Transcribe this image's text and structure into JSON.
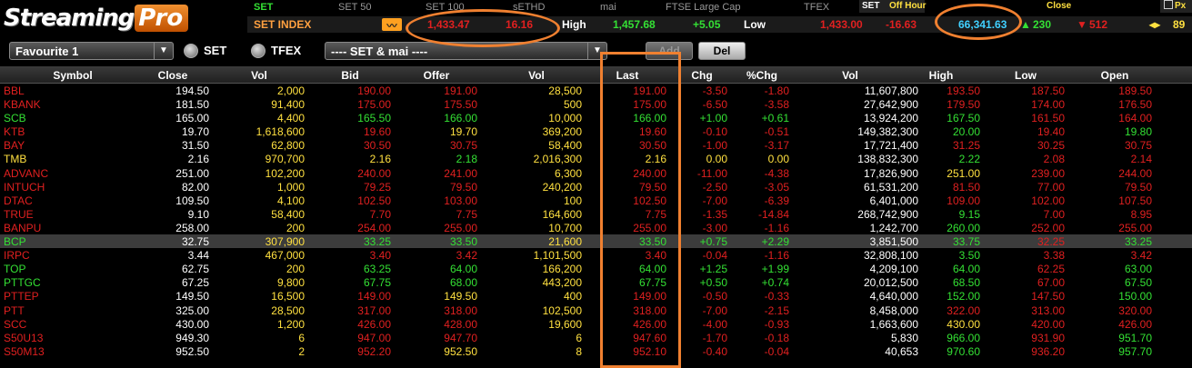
{
  "app": {
    "logo_main": "Streaming",
    "logo_accent": "Pro"
  },
  "tabs": [
    "SET",
    "SET 50",
    "SET 100",
    "sETHD",
    "mai",
    "FTSE Large Cap",
    "TFEX"
  ],
  "status": {
    "market": "SET",
    "session": "Off Hour",
    "close_label": "Close",
    "tab_right": "Px"
  },
  "index_bar": {
    "name": "SET INDEX",
    "value": "1,433.47",
    "change": "16.16",
    "high_label": "High",
    "high": "1,457.68",
    "high_chg": "+5.05",
    "low_label": "Low",
    "low": "1,433.00",
    "low_chg": "-16.63",
    "volume": "66,341.63",
    "up_count": "230",
    "down_count": "512",
    "unch_count": "89"
  },
  "controls": {
    "favourite": "Favourite 1",
    "radio_set": "SET",
    "radio_tfex": "TFEX",
    "market_filter": "---- SET & mai ----",
    "add_label": "Add",
    "del_label": "Del"
  },
  "columns": [
    "Symbol",
    "Close",
    "Vol",
    "Bid",
    "Offer",
    "Vol",
    "Last",
    "Chg",
    "%Chg",
    "Vol",
    "High",
    "Low",
    "Open"
  ],
  "colors": {
    "up": "#34e034",
    "down": "#e02020",
    "volume": "#ffe040",
    "neutral": "#ffffff",
    "highlight": "#f08030"
  },
  "rows": [
    [
      "BBL",
      "194.50",
      "2,000",
      "190.00",
      "191.00",
      "28,500",
      "191.00",
      "-3.50",
      "-1.80",
      "11,607,800",
      "193.50",
      "187.50",
      "189.50",
      "d"
    ],
    [
      "KBANK",
      "181.50",
      "91,400",
      "175.00",
      "175.50",
      "500",
      "175.00",
      "-6.50",
      "-3.58",
      "27,642,900",
      "179.50",
      "174.00",
      "176.50",
      "d"
    ],
    [
      "SCB",
      "165.00",
      "4,400",
      "165.50",
      "166.00",
      "10,000",
      "166.00",
      "+1.00",
      "+0.61",
      "13,924,200",
      "167.50",
      "161.50",
      "164.00",
      "u"
    ],
    [
      "KTB",
      "19.70",
      "1,618,600",
      "19.60",
      "19.70",
      "369,200",
      "19.60",
      "-0.10",
      "-0.51",
      "149,382,300",
      "20.00",
      "19.40",
      "19.80",
      "d"
    ],
    [
      "BAY",
      "31.50",
      "62,800",
      "30.50",
      "30.75",
      "58,400",
      "30.50",
      "-1.00",
      "-3.17",
      "17,721,400",
      "31.25",
      "30.25",
      "30.75",
      "d"
    ],
    [
      "TMB",
      "2.16",
      "970,700",
      "2.16",
      "2.18",
      "2,016,300",
      "2.16",
      "0.00",
      "0.00",
      "138,832,300",
      "2.22",
      "2.08",
      "2.14",
      "n"
    ],
    [
      "ADVANC",
      "251.00",
      "102,200",
      "240.00",
      "241.00",
      "6,300",
      "240.00",
      "-11.00",
      "-4.38",
      "17,826,900",
      "251.00",
      "239.00",
      "244.00",
      "d"
    ],
    [
      "INTUCH",
      "82.00",
      "1,000",
      "79.25",
      "79.50",
      "240,200",
      "79.50",
      "-2.50",
      "-3.05",
      "61,531,200",
      "81.50",
      "77.00",
      "79.50",
      "d"
    ],
    [
      "DTAC",
      "109.50",
      "4,100",
      "102.50",
      "103.00",
      "100",
      "102.50",
      "-7.00",
      "-6.39",
      "6,401,000",
      "109.00",
      "102.00",
      "107.50",
      "d"
    ],
    [
      "TRUE",
      "9.10",
      "58,400",
      "7.70",
      "7.75",
      "164,600",
      "7.75",
      "-1.35",
      "-14.84",
      "268,742,900",
      "9.15",
      "7.00",
      "8.95",
      "d"
    ],
    [
      "BANPU",
      "258.00",
      "200",
      "254.00",
      "255.00",
      "10,700",
      "255.00",
      "-3.00",
      "-1.16",
      "1,242,700",
      "260.00",
      "252.00",
      "255.00",
      "d"
    ],
    [
      "BCP",
      "32.75",
      "307,900",
      "33.25",
      "33.50",
      "21,600",
      "33.50",
      "+0.75",
      "+2.29",
      "3,851,500",
      "33.75",
      "32.25",
      "33.25",
      "u"
    ],
    [
      "IRPC",
      "3.44",
      "467,000",
      "3.40",
      "3.42",
      "1,101,500",
      "3.40",
      "-0.04",
      "-1.16",
      "32,808,100",
      "3.50",
      "3.38",
      "3.42",
      "d"
    ],
    [
      "TOP",
      "62.75",
      "200",
      "63.25",
      "64.00",
      "166,200",
      "64.00",
      "+1.25",
      "+1.99",
      "4,209,100",
      "64.00",
      "62.25",
      "63.00",
      "u"
    ],
    [
      "PTTGC",
      "67.25",
      "9,800",
      "67.75",
      "68.00",
      "443,200",
      "67.75",
      "+0.50",
      "+0.74",
      "20,012,500",
      "68.50",
      "67.00",
      "67.50",
      "u"
    ],
    [
      "PTTEP",
      "149.50",
      "16,500",
      "149.00",
      "149.50",
      "400",
      "149.00",
      "-0.50",
      "-0.33",
      "4,640,000",
      "152.00",
      "147.50",
      "150.00",
      "d"
    ],
    [
      "PTT",
      "325.00",
      "28,500",
      "317.00",
      "318.00",
      "102,500",
      "318.00",
      "-7.00",
      "-2.15",
      "8,458,000",
      "322.00",
      "313.00",
      "320.00",
      "d"
    ],
    [
      "SCC",
      "430.00",
      "1,200",
      "426.00",
      "428.00",
      "19,600",
      "426.00",
      "-4.00",
      "-0.93",
      "1,663,600",
      "430.00",
      "420.00",
      "426.00",
      "d"
    ],
    [
      "S50U13",
      "949.30",
      "6",
      "947.00",
      "947.70",
      "6",
      "947.60",
      "-1.70",
      "-0.18",
      "5,830",
      "966.00",
      "931.90",
      "951.70",
      "d"
    ],
    [
      "S50M13",
      "952.50",
      "2",
      "952.20",
      "952.50",
      "8",
      "952.10",
      "-0.40",
      "-0.04",
      "40,653",
      "970.60",
      "936.20",
      "957.70",
      "d"
    ]
  ]
}
